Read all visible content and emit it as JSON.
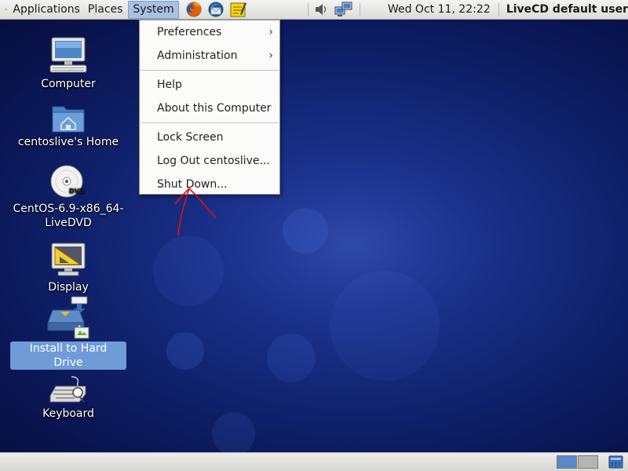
{
  "top_panel": {
    "menus": {
      "applications": "Applications",
      "places": "Places",
      "system": "System"
    },
    "launchers": [
      "firefox-icon",
      "thunderbird-icon",
      "notes-icon"
    ],
    "tray_icons": [
      "volume-icon",
      "network-icon"
    ],
    "clock": "Wed Oct 11, 22:22",
    "user": "LiveCD default user"
  },
  "desktop": {
    "icons": [
      {
        "label": "Computer",
        "icon": "computer-icon"
      },
      {
        "label": "centoslive's Home",
        "icon": "home-folder-icon"
      },
      {
        "label_line1": "CentOS-6.9-x86_64-",
        "label_line2": "LiveDVD",
        "icon": "dvd-icon"
      },
      {
        "label": "Display",
        "icon": "display-icon"
      },
      {
        "label": "Install to Hard Drive",
        "icon": "install-icon",
        "selected": true
      },
      {
        "label": "Keyboard",
        "icon": "keyboard-icon"
      }
    ]
  },
  "system_menu": {
    "items": [
      {
        "label": "Preferences",
        "submenu": true
      },
      {
        "label": "Administration",
        "submenu": true
      },
      {
        "label": "Help"
      },
      {
        "label": "About this Computer"
      },
      {
        "label": "Lock Screen"
      },
      {
        "label": "Log Out centoslive..."
      },
      {
        "label": "Shut Down..."
      }
    ],
    "submenu_glyph": "›"
  },
  "bottom_panel": {
    "workspaces": 2,
    "active_workspace": 1
  },
  "colors": {
    "menu_highlight": "#a8c1e3",
    "selection": "#6f9bd6",
    "annotation": "#e01010",
    "desktop_blue": "#102470"
  }
}
